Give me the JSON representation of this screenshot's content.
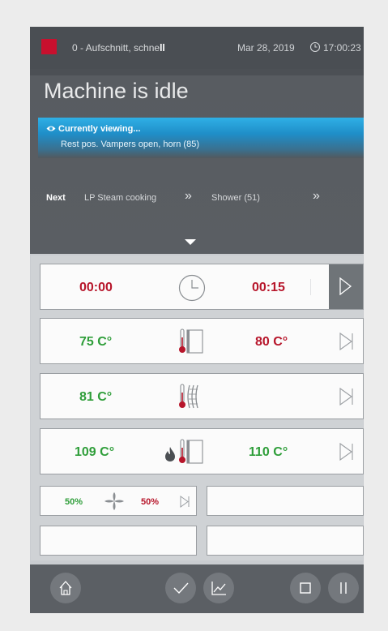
{
  "topbar": {
    "program": "0 - Aufschnitt, schne",
    "program_bold": "ll",
    "date": "Mar 28, 2019",
    "time": "17:00:23"
  },
  "status": {
    "text": "Machine is idle"
  },
  "viewing": {
    "title": "Currently viewing...",
    "step": "Rest pos. Vampers open, horn (85)"
  },
  "next": {
    "label": "Next",
    "step1": "LP Steam cooking",
    "step2": "Shower (51)"
  },
  "rows": {
    "timer": {
      "current": "00:00",
      "target": "00:15"
    },
    "chamber": {
      "current": "75 C°",
      "target": "80 C°"
    },
    "core": {
      "current": "81 C°"
    },
    "heating": {
      "current": "109 C°",
      "target": "110 C°"
    },
    "fan": {
      "current": "50%",
      "target": "50%"
    }
  },
  "colors": {
    "accent_blue": "#2fb0e6",
    "actual_green": "#2f9e3a",
    "target_red": "#b7162b",
    "stop_red": "#c8102e"
  },
  "icons": [
    "home-icon",
    "check-icon",
    "chart-icon",
    "stop-icon",
    "pause-icon",
    "clock-icon",
    "eye-icon",
    "thermometer-door-icon",
    "core-probe-icon",
    "flame-icon",
    "fan-icon"
  ]
}
